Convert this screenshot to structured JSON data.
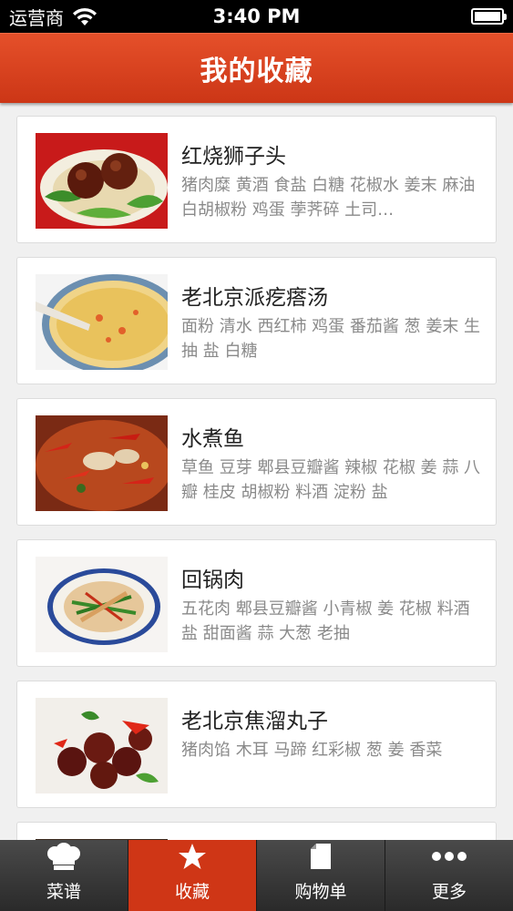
{
  "status_bar": {
    "carrier": "运营商",
    "time": "3:40 PM"
  },
  "header": {
    "title": "我的收藏"
  },
  "favorites": [
    {
      "title": "红烧狮子头",
      "ingredients": "猪肉糜 黄酒 食盐 白糖 花椒水 姜末 麻油 白胡椒粉 鸡蛋 荸荠碎 土司…"
    },
    {
      "title": "老北京派疙瘩汤",
      "ingredients": "面粉 清水 西红柿 鸡蛋 番茄酱 葱 姜末 生抽 盐 白糖"
    },
    {
      "title": "水煮鱼",
      "ingredients": "草鱼 豆芽 郫县豆瓣酱 辣椒 花椒 姜 蒜 八瓣 桂皮 胡椒粉 料酒 淀粉 盐"
    },
    {
      "title": "回锅肉",
      "ingredients": "五花肉 郫县豆瓣酱 小青椒 姜 花椒 料酒 盐 甜面酱 蒜 大葱 老抽"
    },
    {
      "title": "老北京焦溜丸子",
      "ingredients": "猪肉馅 木耳 马蹄 红彩椒 葱 姜 香菜"
    }
  ],
  "tab_bar": {
    "tabs": [
      {
        "label": "菜谱",
        "icon": "chef-hat-icon"
      },
      {
        "label": "收藏",
        "icon": "star-icon"
      },
      {
        "label": "购物单",
        "icon": "document-icon"
      },
      {
        "label": "更多",
        "icon": "more-dots-icon"
      }
    ],
    "active_index": 1
  },
  "colors": {
    "header_red": "#d8401c",
    "active_tab": "#cf3616",
    "tab_bar": "#333333"
  }
}
